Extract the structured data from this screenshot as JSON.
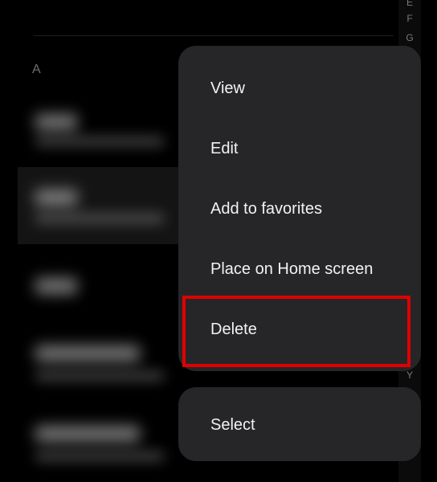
{
  "contacts": {
    "section_letter": "A"
  },
  "index_bar": {
    "letters_top": [
      "E",
      "F",
      "G"
    ],
    "letters_bottom": [
      "Y"
    ]
  },
  "context_menu": {
    "items": [
      "View",
      "Edit",
      "Add to favorites",
      "Place on Home screen",
      "Delete"
    ],
    "secondary_item": "Select"
  },
  "annotation": {
    "highlight_color": "#e00000",
    "highlighted_item": "Delete"
  }
}
